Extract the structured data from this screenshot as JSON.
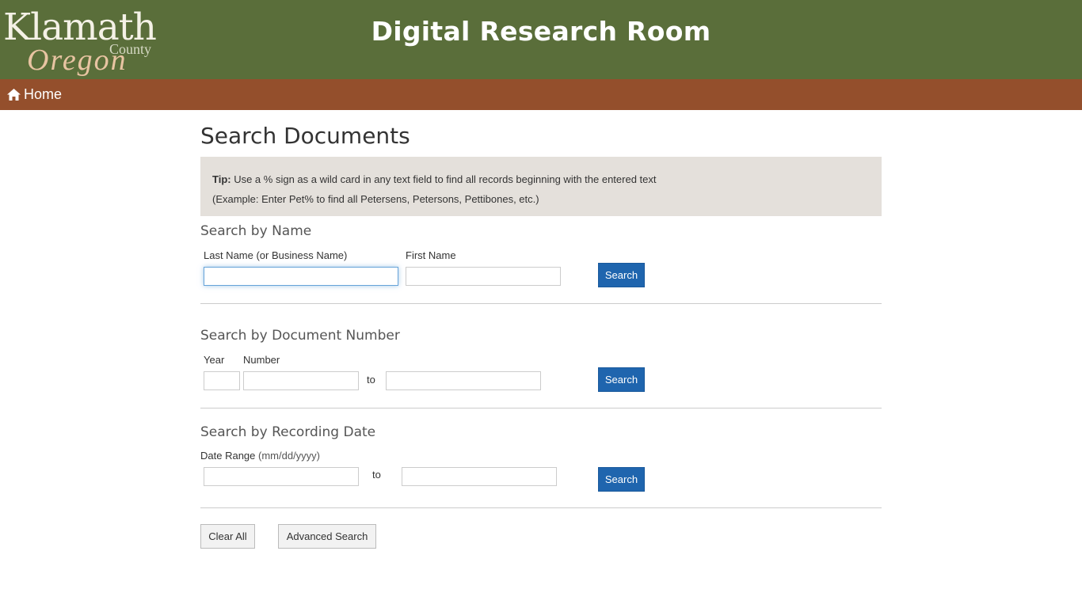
{
  "header": {
    "logo": {
      "line1": "Klamath",
      "line2": "County",
      "line3": "Oregon"
    },
    "title": "Digital Research Room"
  },
  "nav": {
    "home_label": "Home",
    "home_icon": "home-icon"
  },
  "main": {
    "title": "Search Documents",
    "tip": {
      "bold": "Tip:",
      "line1": " Use a % sign as a wild card in any text field to find all records beginning with the entered text",
      "line2": "(Example: Enter Pet% to find all Petersens, Petersons, Pettibones, etc.)"
    },
    "by_name": {
      "title": "Search by Name",
      "last_name_label": "Last Name (or Business Name)",
      "last_name_value": "",
      "first_name_label": "First Name",
      "first_name_value": "",
      "search_label": "Search"
    },
    "by_doc": {
      "title": "Search by Document Number",
      "year_label": "Year",
      "number_label": "Number",
      "to_label": "to",
      "year_value": "",
      "number_from_value": "",
      "number_to_value": "",
      "search_label": "Search"
    },
    "by_date": {
      "title": "Search by Recording Date",
      "range_label": "Date Range",
      "format_hint": "(mm/dd/yyyy)",
      "to_label": "to",
      "from_value": "",
      "to_value": "",
      "search_label": "Search"
    },
    "actions": {
      "clear_label": "Clear All",
      "advanced_label": "Advanced Search"
    }
  }
}
